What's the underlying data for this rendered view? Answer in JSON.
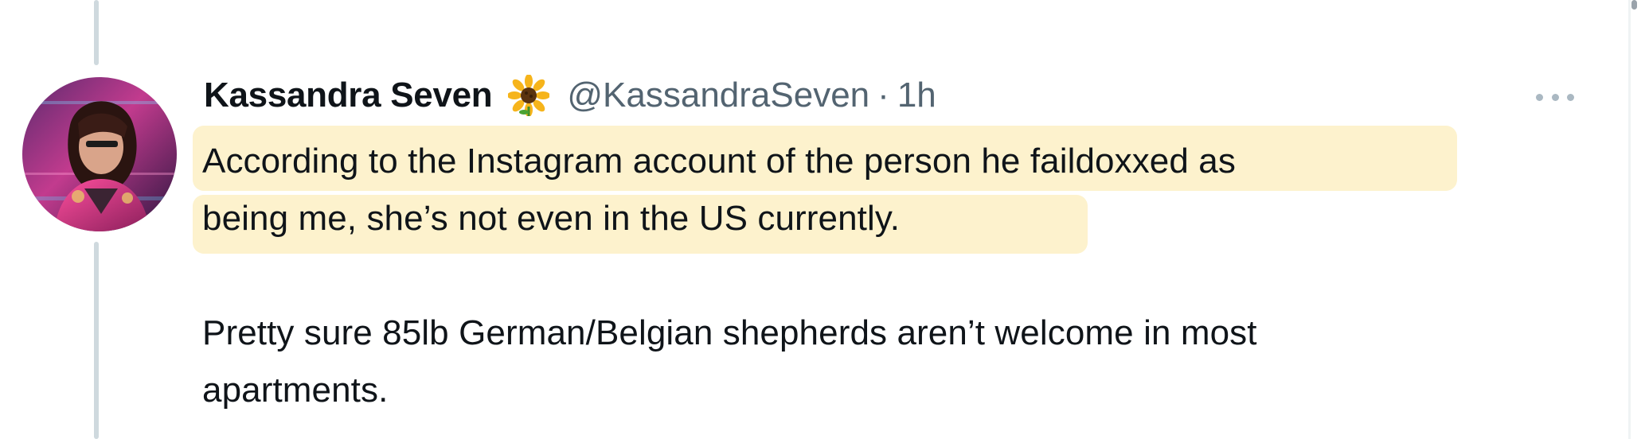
{
  "tweet": {
    "author_name": "Kassandra Seven",
    "author_emoji": "sunflower",
    "handle": "@KassandraSeven",
    "separator": "·",
    "time": "1h",
    "paragraph1": [
      "According to the Instagram account of the person he faildoxxed as",
      "being me, she’s not even in the US currently."
    ],
    "paragraph2": [
      "Pretty sure 85lb German/Belgian shepherds aren’t welcome in most",
      "apartments."
    ]
  },
  "colors": {
    "highlight": "#fdf2cd",
    "secondary_text": "#536471",
    "thread_line": "#cfd9de"
  },
  "icons": {
    "more": "more-horizontal-icon",
    "emoji": "sunflower-icon"
  }
}
